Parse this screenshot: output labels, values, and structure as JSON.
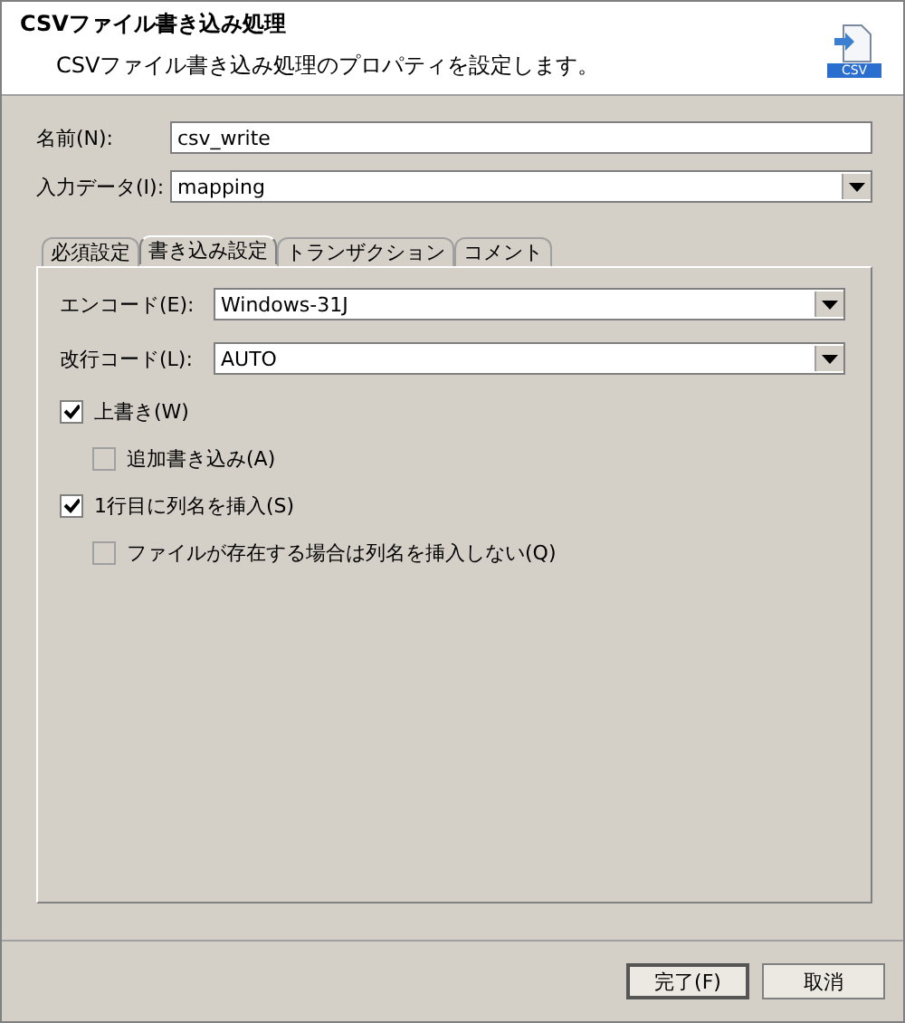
{
  "header": {
    "title": "CSVファイル書き込み処理",
    "description": "CSVファイル書き込み処理のプロパティを設定します。",
    "icon_label": "CSV"
  },
  "fields": [
    {
      "kind": "text",
      "label": "名前(N):",
      "value": "csv_write"
    },
    {
      "kind": "select",
      "label": "入力データ(I):",
      "value": "mapping"
    }
  ],
  "tabs": [
    {
      "label": "必須設定",
      "selected": false
    },
    {
      "label": "書き込み設定",
      "selected": true
    },
    {
      "label": "トランザクション",
      "selected": false
    },
    {
      "label": "コメント",
      "selected": false
    }
  ],
  "tab_fields": [
    {
      "kind": "select",
      "label": "エンコード(E):",
      "value": "Windows-31J"
    },
    {
      "kind": "select",
      "label": "改行コード(L):",
      "value": "AUTO"
    }
  ],
  "options": [
    {
      "label": "上書き(W)",
      "checked": true,
      "children": [
        {
          "label": "追加書き込み(A)",
          "checked": false,
          "disabled": true
        }
      ]
    },
    {
      "label": "1行目に列名を挿入(S)",
      "checked": true,
      "children": [
        {
          "label": "ファイルが存在する場合は列名を挿入しない(Q)",
          "checked": false,
          "disabled": true
        }
      ]
    }
  ],
  "buttons": [
    {
      "label": "完了(F)",
      "default": true
    },
    {
      "label": "取消",
      "default": false
    }
  ]
}
